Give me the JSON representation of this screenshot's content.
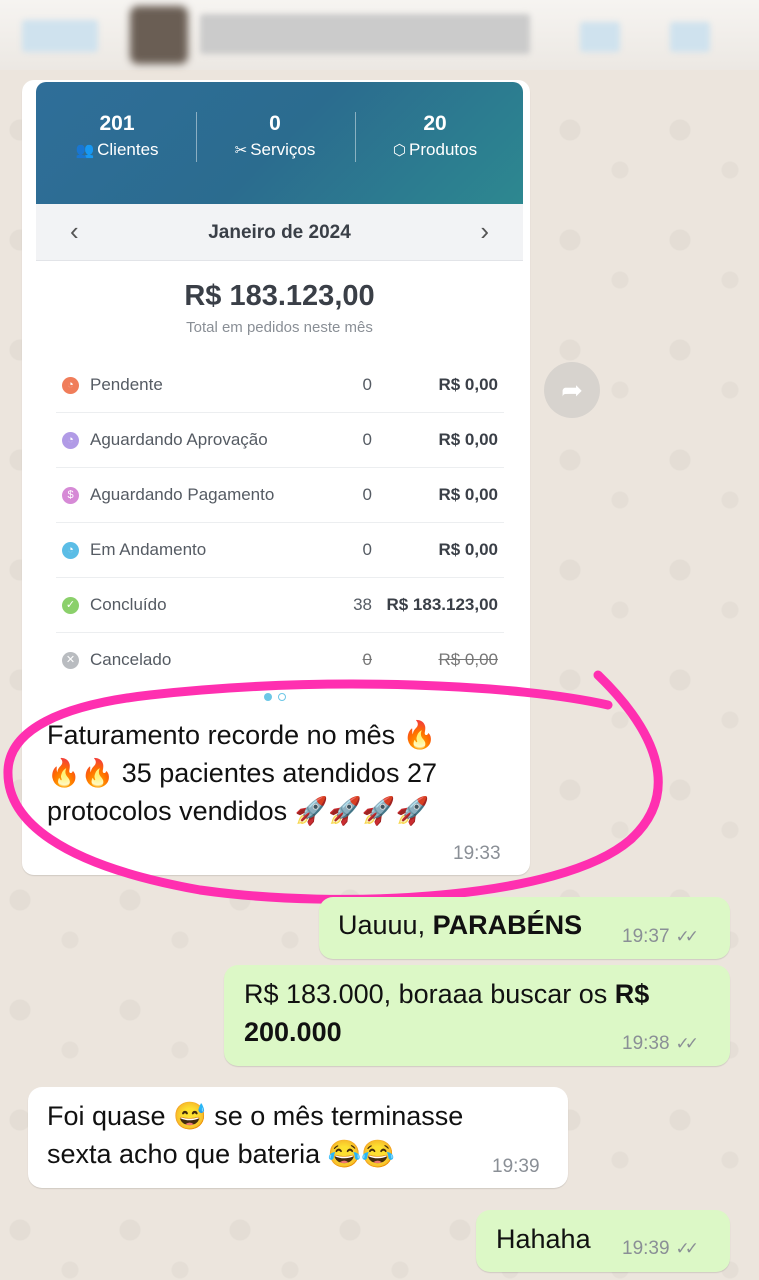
{
  "stats": [
    {
      "value": "201",
      "label": "Clientes",
      "icon": "users-icon"
    },
    {
      "value": "0",
      "label": "Serviços",
      "icon": "tools-icon"
    },
    {
      "value": "20",
      "label": "Produtos",
      "icon": "box-icon"
    }
  ],
  "month": "Janeiro de 2024",
  "total": "R$ 183.123,00",
  "total_sub": "Total em pedidos neste mês",
  "statuses": [
    {
      "label": "Pendente",
      "count": "0",
      "value": "R$ 0,00",
      "color": "#f07d5a",
      "icon": "clock-icon"
    },
    {
      "label": "Aguardando Aprovação",
      "count": "0",
      "value": "R$ 0,00",
      "color": "#b19be6",
      "icon": "clock-icon"
    },
    {
      "label": "Aguardando Pagamento",
      "count": "0",
      "value": "R$ 0,00",
      "color": "#d68ad6",
      "icon": "dollar-icon"
    },
    {
      "label": "Em Andamento",
      "count": "0",
      "value": "R$ 0,00",
      "color": "#5bbde6",
      "icon": "clock-icon"
    },
    {
      "label": "Concluído",
      "count": "38",
      "value": "R$ 183.123,00",
      "color": "#8bd06b",
      "icon": "check-icon"
    },
    {
      "label": "Cancelado",
      "count": "0",
      "value": "R$ 0,00",
      "color": "#b9bcc0",
      "icon": "x-icon"
    }
  ],
  "caption": {
    "line1": "Faturamento recorde no mês 🔥",
    "line2": "🔥🔥 35 pacientes atendidos 27",
    "line3": "protocolos vendidos 🚀🚀🚀🚀",
    "time": "19:33"
  },
  "messages": [
    {
      "from": "out",
      "text_plain": "Uauuu, ",
      "text_bold": "PARABÉNS",
      "time": "19:37"
    },
    {
      "from": "out",
      "text_plain": "R$ 183.000, boraaa buscar os ",
      "text_bold": "R$",
      "text_bold2": "200.000",
      "time": "19:38"
    },
    {
      "from": "in",
      "line1": "Foi quase 😅 se o mês terminasse",
      "line2": "sexta acho que bateria 😂😂",
      "time": "19:39"
    },
    {
      "from": "out",
      "text_plain": "Hahaha",
      "time": "19:39"
    }
  ],
  "ticks": "✓✓",
  "accent": "#ff2fb0"
}
